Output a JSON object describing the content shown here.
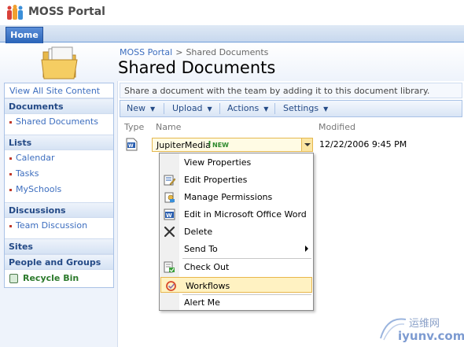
{
  "site": {
    "title": "MOSS Portal"
  },
  "tabs": [
    {
      "label": "Home"
    }
  ],
  "header": {
    "breadcrumb": {
      "root": "MOSS Portal",
      "separator": ">",
      "current": "Shared Documents"
    },
    "page_title": "Shared Documents"
  },
  "leftnav": {
    "view_all": "View All Site Content",
    "sections": {
      "documents": {
        "title": "Documents",
        "items": [
          "Shared Documents"
        ]
      },
      "lists": {
        "title": "Lists",
        "items": [
          "Calendar",
          "Tasks",
          "MySchools"
        ]
      },
      "discussions": {
        "title": "Discussions",
        "items": [
          "Team Discussion"
        ]
      },
      "sites": {
        "title": "Sites"
      },
      "people": {
        "title": "People and Groups"
      }
    },
    "recycle_bin": "Recycle Bin"
  },
  "main": {
    "description": "Share a document with the team by adding it to this document library.",
    "toolbar": {
      "new": "New",
      "upload": "Upload",
      "actions": "Actions",
      "settings": "Settings"
    },
    "columns": {
      "type": "Type",
      "name": "Name",
      "modified": "Modified"
    },
    "rows": [
      {
        "name": "JupiterMedia",
        "flag": "!",
        "new_label": "NEW",
        "modified": "12/22/2006 9:45 PM",
        "icon": "word-doc-icon"
      }
    ]
  },
  "context_menu": {
    "items": [
      {
        "label": "View Properties",
        "icon": ""
      },
      {
        "label": "Edit Properties",
        "icon": "edit-properties-icon"
      },
      {
        "label": "Manage Permissions",
        "icon": "permissions-icon"
      },
      {
        "label": "Edit in Microsoft Office Word",
        "icon": "word-icon"
      },
      {
        "label": "Delete",
        "icon": "delete-x-icon"
      },
      {
        "label": "Send To",
        "icon": "",
        "submenu": true
      },
      {
        "label": "Check Out",
        "icon": "check-out-icon"
      },
      {
        "label": "Workflows",
        "icon": "workflows-icon",
        "highlighted": true
      },
      {
        "label": "Alert Me",
        "icon": ""
      }
    ]
  },
  "watermark": {
    "cn": "运维网",
    "en": "iyunv.com"
  },
  "colors": {
    "tab_active": "#2a64b8",
    "link": "#3d6ebf",
    "nav_head": "#244a86",
    "highlight_bg": "#fff2c2",
    "highlight_border": "#e8b64c"
  }
}
